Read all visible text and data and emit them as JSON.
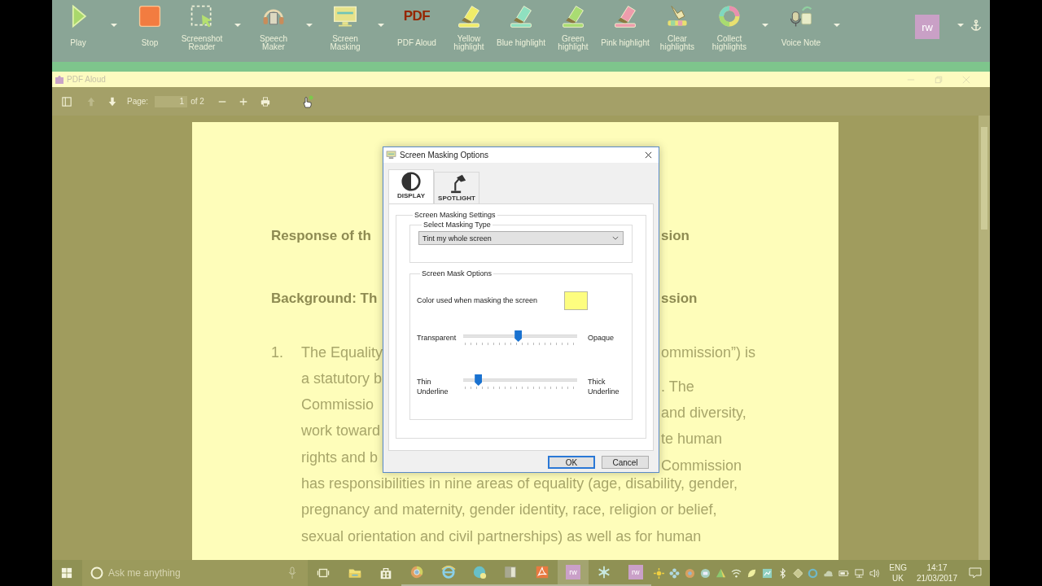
{
  "toolbar": {
    "items": [
      {
        "label": "Play",
        "dropdown": true
      },
      {
        "label": "Stop",
        "dropdown": false
      },
      {
        "label": "Screenshot Reader",
        "dropdown": true
      },
      {
        "label": "Speech Maker",
        "dropdown": true
      },
      {
        "label": "Screen Masking",
        "dropdown": true
      },
      {
        "label": "PDF Aloud",
        "dropdown": false,
        "icon_text": "PDF"
      },
      {
        "label": "Yellow highlight",
        "dropdown": false
      },
      {
        "label": "Blue highlight",
        "dropdown": false
      },
      {
        "label": "Green highlight",
        "dropdown": false
      },
      {
        "label": "Pink highlight",
        "dropdown": false
      },
      {
        "label": "Clear highlights",
        "dropdown": false
      },
      {
        "label": "Collect highlights",
        "dropdown": true
      },
      {
        "label": "Voice Note",
        "dropdown": true
      }
    ],
    "logo": {
      "text": "rw",
      "dropdown": true
    }
  },
  "app_window": {
    "title": "PDF Aloud"
  },
  "pdf_toolbar": {
    "page_label": "Page:",
    "page_value": "1",
    "page_count": "of 2",
    "previous_disabled": true
  },
  "document": {
    "lines": [
      {
        "kind": "heading",
        "left": "Response of th",
        "right": "sion"
      },
      {
        "kind": "heading",
        "left": "Background: Th",
        "right": "ssion"
      },
      {
        "kind": "item",
        "number": "1.",
        "left": "The Equality",
        "right": "ommission”) is"
      },
      {
        "kind": "text",
        "left": "a statutory b",
        "right": ". The"
      },
      {
        "kind": "text",
        "left": "Commissio",
        "right": "and diversity,"
      },
      {
        "kind": "text",
        "left": "work toward",
        "right": "te human"
      },
      {
        "kind": "text",
        "left": "rights and b",
        "right": "Commission"
      },
      {
        "kind": "text",
        "left": "has responsibilities in nine areas of equality (age, disability, gender,"
      },
      {
        "kind": "text",
        "left": "pregnancy and maternity, gender identity, race, religion or belief,"
      },
      {
        "kind": "text",
        "left": "sexual orientation and civil partnerships) as well as for human"
      }
    ]
  },
  "dialog": {
    "title": "Screen Masking Options",
    "tabs": [
      {
        "label": "DISPLAY",
        "selected": true
      },
      {
        "label": "SPOTLIGHT",
        "selected": false
      }
    ],
    "settings_group": "Screen Masking Settings",
    "type_group": "Select Masking Type",
    "masking_type": "Tint my whole screen",
    "options_group": "Screen Mask Options",
    "color_label": "Color used when masking the screen",
    "sliders": [
      {
        "left_label": "Transparent",
        "right_label": "Opaque",
        "level": 0.48
      },
      {
        "left_label": "Thin Underline",
        "right_label": "Thick Underline",
        "level": 0.13
      }
    ],
    "buttons": [
      {
        "label": "OK",
        "default": true
      },
      {
        "label": "Cancel",
        "default": false
      }
    ]
  },
  "taskbar": {
    "search_placeholder": "Ask me anything",
    "apps": [
      {
        "running": false,
        "selected": false
      },
      {
        "running": false,
        "selected": false
      },
      {
        "running": false,
        "selected": false
      },
      {
        "running": true,
        "selected": false
      },
      {
        "running": true,
        "selected": false
      },
      {
        "running": true,
        "selected": false
      },
      {
        "running": true,
        "selected": false
      },
      {
        "running": true,
        "selected": false
      },
      {
        "running": true,
        "selected": true,
        "text": "rw"
      },
      {
        "running": true,
        "selected": false
      },
      {
        "running": true,
        "selected": false,
        "text": "rw"
      }
    ],
    "language": "ENG",
    "region": "UK",
    "time": "14:17",
    "date": "21/03/2017"
  }
}
